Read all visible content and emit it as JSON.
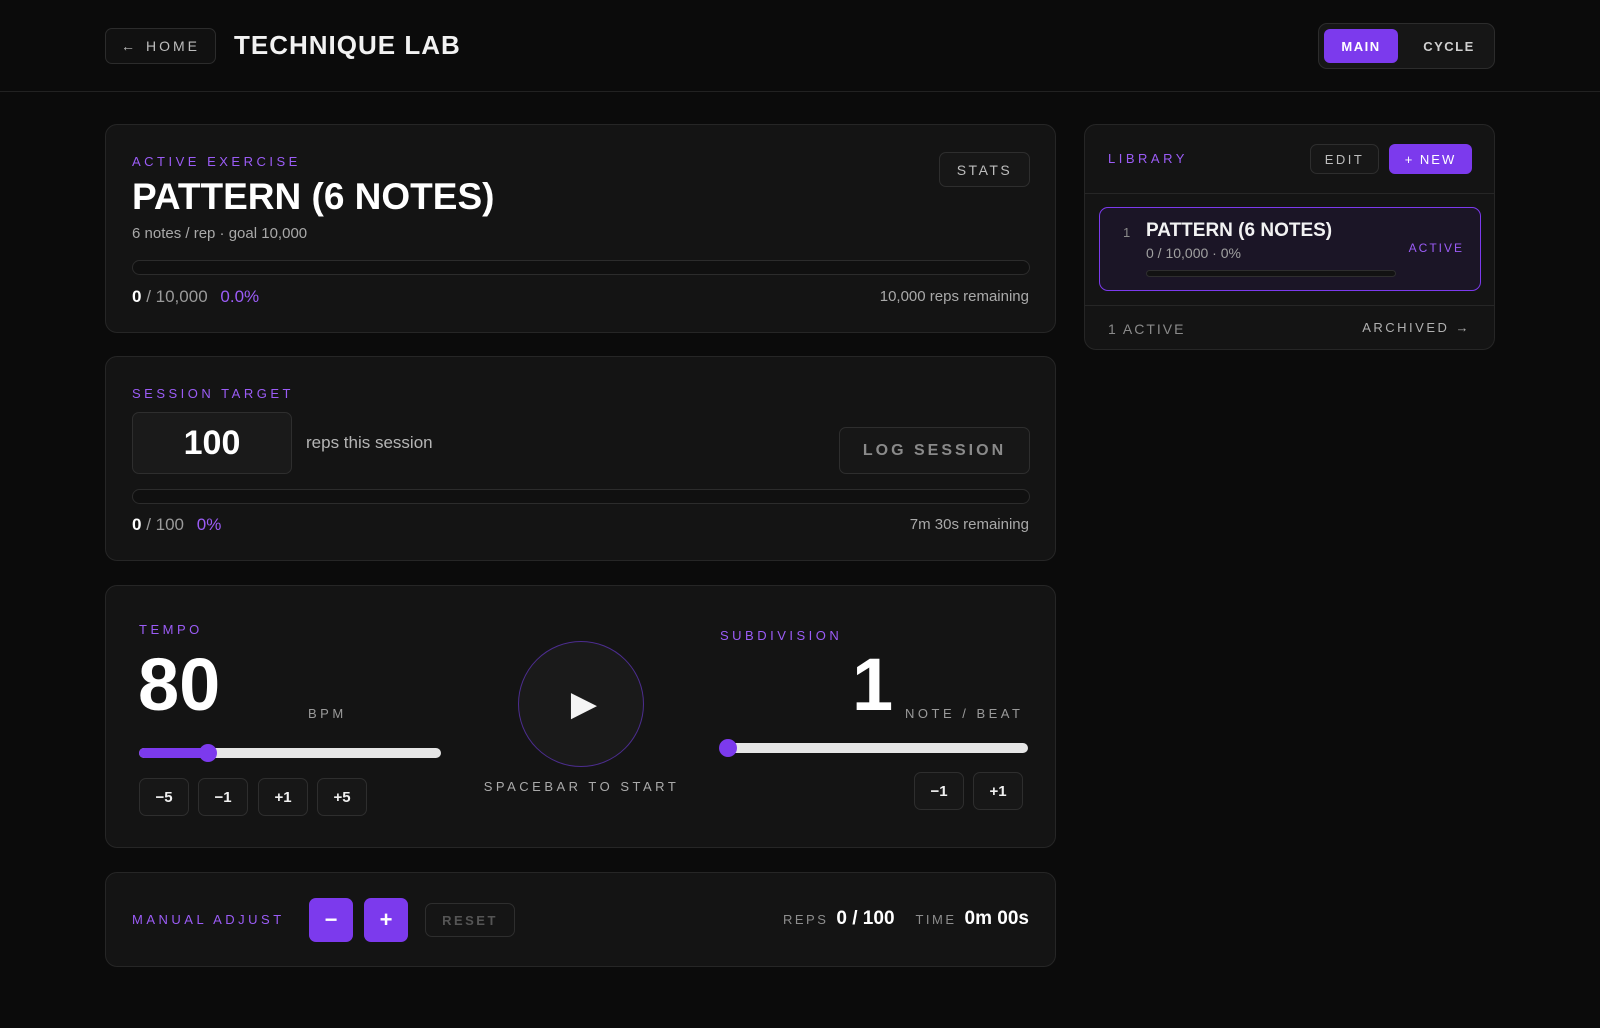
{
  "header": {
    "home_arrow": "←",
    "home_label": "HOME",
    "title": "TECHNIQUE LAB",
    "modes": [
      {
        "label": "MAIN",
        "active": true
      },
      {
        "label": "CYCLE",
        "active": false
      }
    ]
  },
  "active_exercise": {
    "section_label": "ACTIVE EXERCISE",
    "stats_label": "STATS",
    "name": "PATTERN (6 NOTES)",
    "subtitle": "6 notes / rep · goal 10,000",
    "progress_fraction": 0,
    "count": "0",
    "goal_text": "/ 10,000",
    "percent": "0.0%",
    "remaining": "10,000 reps remaining"
  },
  "session": {
    "section_label": "SESSION TARGET",
    "target_value": "100",
    "target_suffix": "reps this session",
    "log_label": "LOG SESSION",
    "progress_fraction": 0,
    "count": "0",
    "goal_text": "/ 100",
    "percent": "0%",
    "remaining": "7m 30s remaining"
  },
  "tempo": {
    "label": "TEMPO",
    "value": "80",
    "unit": "BPM",
    "slider_fraction": 0.23,
    "buttons": [
      "−5",
      "−1",
      "+1",
      "+5"
    ]
  },
  "play": {
    "icon": "▶",
    "hint": "SPACEBAR TO START"
  },
  "subdivision": {
    "label": "SUBDIVISION",
    "value": "1",
    "unit": "NOTE / BEAT",
    "slider_fraction": 0,
    "buttons": [
      "−1",
      "+1"
    ]
  },
  "manual": {
    "label": "MANUAL ADJUST",
    "minus": "−",
    "plus": "+",
    "reset": "RESET",
    "reps_label": "REPS",
    "reps_value": "0 / 100",
    "time_label": "TIME",
    "time_value": "0m 00s"
  },
  "library": {
    "label": "LIBRARY",
    "edit_label": "EDIT",
    "new_label": "+ NEW",
    "items": [
      {
        "index": "1",
        "name": "PATTERN (6 NOTES)",
        "detail": "0 / 10,000 · 0%",
        "status": "ACTIVE",
        "progress_fraction": 0
      }
    ],
    "footer_count": "1 ACTIVE",
    "archived_label": "ARCHIVED →"
  },
  "colors": {
    "accent": "#7c3aed",
    "accent_text": "#9b5cf6",
    "background": "#0b0b0b",
    "card": "#141414"
  }
}
